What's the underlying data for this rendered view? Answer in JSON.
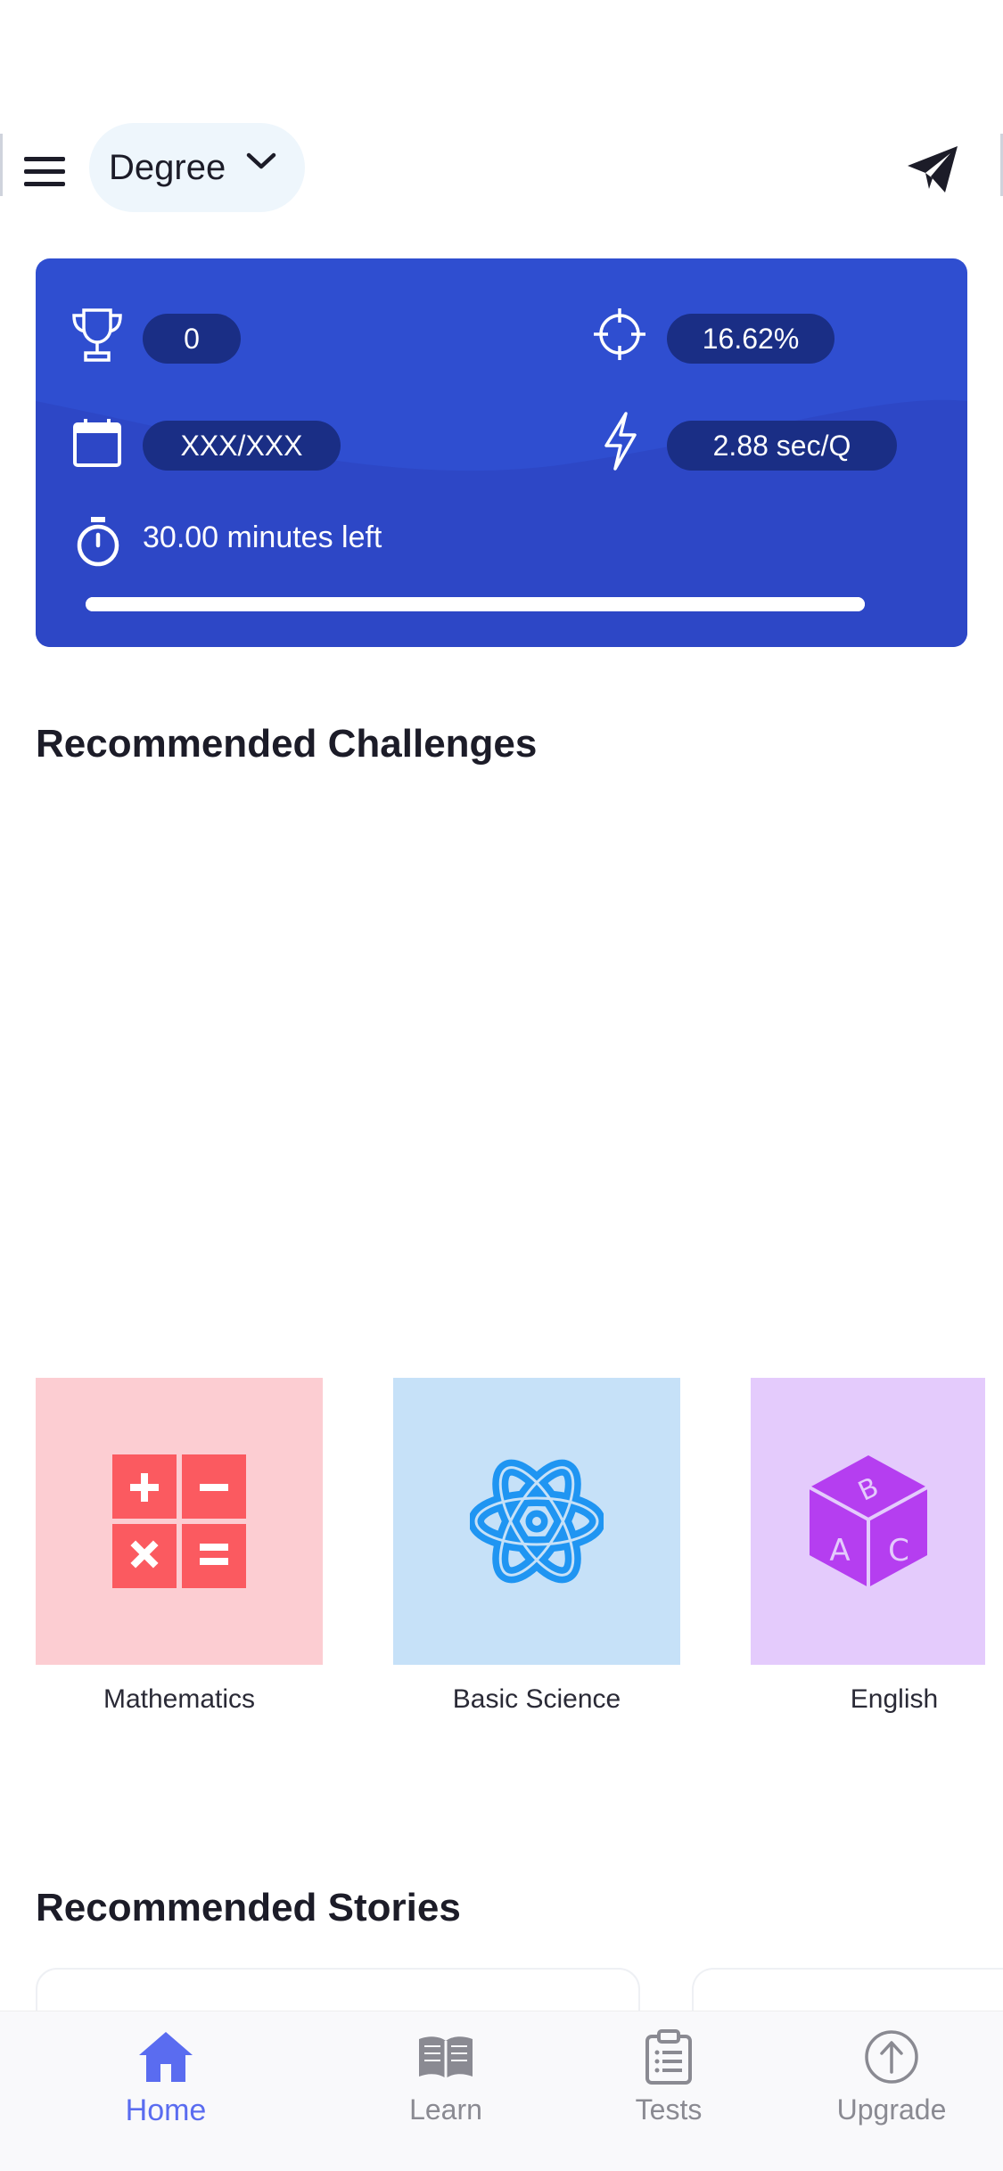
{
  "header": {
    "degree_label": "Degree",
    "icons": {
      "menu": "hamburger-icon",
      "dropdown": "chevron-down-icon",
      "share": "paper-plane-icon"
    }
  },
  "stats": {
    "score": "0",
    "accuracy": "16.62%",
    "attempted": "XXX/XXX",
    "speed": "2.88 sec/Q",
    "time_left": "30.00 minutes left",
    "time_progress_percent": 100,
    "icons": {
      "score": "trophy-icon",
      "accuracy": "crosshair-icon",
      "attempted": "calendar-icon",
      "speed": "lightning-icon",
      "timer": "stopwatch-icon"
    }
  },
  "challenges": {
    "title": "Recommended Challenges",
    "items": [
      {
        "label": "Mathematics",
        "icon": "calculator-icon",
        "bg": "#fccdd2",
        "fg": "#fb5a60"
      },
      {
        "label": "Basic Science",
        "icon": "atom-icon",
        "bg": "#c6e1f8",
        "fg": "#1f95f2"
      },
      {
        "label": "English",
        "icon": "abc-cube-icon",
        "bg": "#e4cbfc",
        "fg": "#b53ef0"
      }
    ]
  },
  "stories": {
    "title": "Recommended Stories"
  },
  "nav": {
    "items": [
      {
        "label": "Home",
        "icon": "home-icon",
        "active": true
      },
      {
        "label": "Learn",
        "icon": "book-icon",
        "active": false
      },
      {
        "label": "Tests",
        "icon": "clipboard-icon",
        "active": false
      },
      {
        "label": "Upgrade",
        "icon": "arrow-up-circle-icon",
        "active": false
      }
    ]
  },
  "colors": {
    "card_bg": "#2f4ed0",
    "pill_bg": "#1a2e85",
    "accent": "#5a6cf0",
    "text": "#1c1c28"
  }
}
